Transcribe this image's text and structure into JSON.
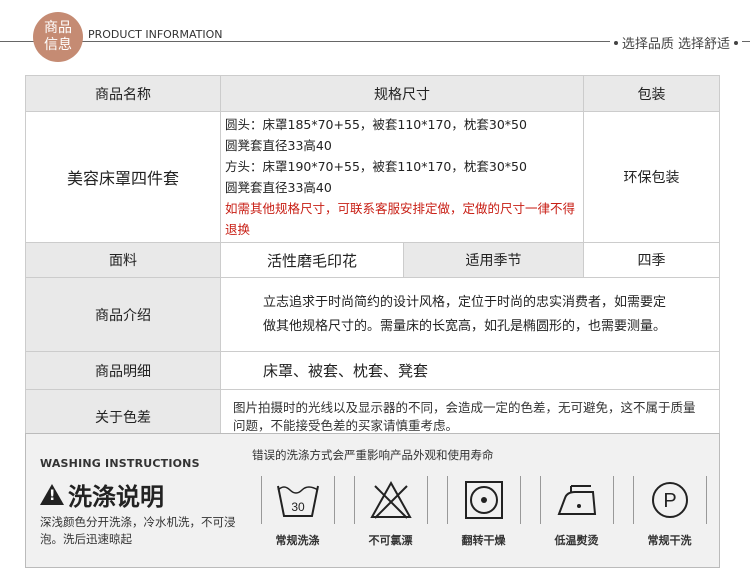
{
  "header": {
    "badge": [
      "商品",
      "信息"
    ],
    "title": "PRODUCT INFORMATION",
    "tagline": "选择品质  选择舒适"
  },
  "table": {
    "headers": [
      "商品名称",
      "规格尺寸",
      "包装"
    ],
    "product": {
      "name": "美容床罩四件套",
      "spec_lines": [
        "圆头：床罩185*70+55，被套110*170，枕套30*50",
        "圆凳套直径33高40",
        "方头：床罩190*70+55，被套110*170，枕套30*50",
        "圆凳套直径33高40"
      ],
      "spec_note": "如需其他规格尺寸，可联系客服安排定做，定做的尺寸一律不得退换",
      "packaging": "环保包装"
    },
    "fabric": {
      "label": "面料",
      "value": "活性磨毛印花",
      "season_label": "适用季节",
      "season_value": "四季"
    },
    "intro": {
      "label": "商品介绍",
      "text": "立志追求于时尚简约的设计风格，定位于时尚的忠实消费者，如需要定做其他规格尺寸的。需量床的长宽高，如孔是椭圆形的，也需要测量。"
    },
    "details": {
      "label": "商品明细",
      "text": "床罩、被套、枕套、凳套"
    },
    "color": {
      "label": "关于色差",
      "text": "图片拍摄时的光线以及显示器的不同，会造成一定的色差，无可避免，这不属于质量问题，不能接受色差的买家请慎重考虑。"
    }
  },
  "washing": {
    "title_en": "WASHING  INSTRUCTIONS",
    "title_cn": "洗涤说明",
    "note": "深浅颜色分开洗涤，冷水机洗，不可浸泡。洗后迅速晾起",
    "subtitle": "错误的洗涤方式会严重影响产品外观和使用寿命",
    "icons": [
      {
        "icon": "wash-30-icon",
        "label": "常规洗涤",
        "number": "30"
      },
      {
        "icon": "no-bleach-icon",
        "label": "不可氯漂"
      },
      {
        "icon": "tumble-dry-icon",
        "label": "翻转干燥"
      },
      {
        "icon": "low-iron-icon",
        "label": "低温熨烫"
      },
      {
        "icon": "dry-clean-p-icon",
        "label": "常规干洗",
        "letter": "P"
      }
    ]
  }
}
